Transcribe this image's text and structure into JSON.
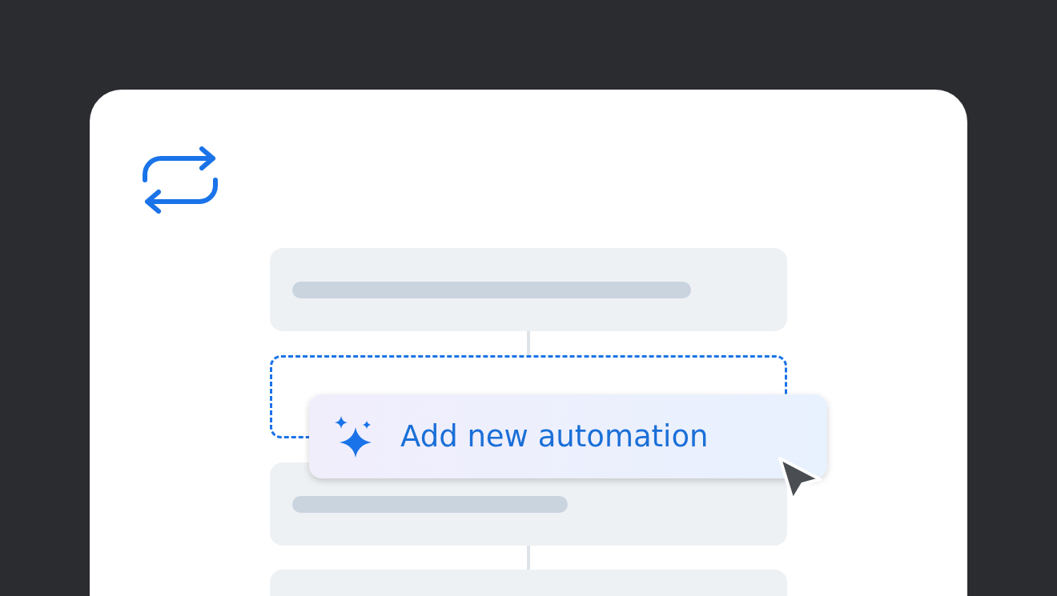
{
  "popup_button": {
    "label": "Add new automation"
  }
}
